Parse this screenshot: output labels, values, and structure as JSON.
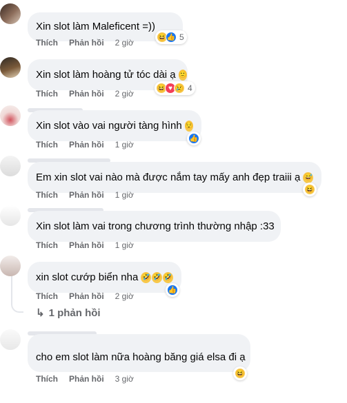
{
  "comments": [
    {
      "text": "Xin slot làm Maleficent =))",
      "reactions": {
        "icons": [
          "haha",
          "like"
        ],
        "count": "5"
      },
      "actions": {
        "like": "Thích",
        "reply": "Phản hồi",
        "time": "2 giờ"
      }
    },
    {
      "text": "Xin slot làm hoàng tử tóc dài ạ",
      "emoji": "slight-smile-emoji",
      "reactions": {
        "icons": [
          "haha",
          "love",
          "sad"
        ],
        "count": "4"
      },
      "actions": {
        "like": "Thích",
        "reply": "Phản hồi",
        "time": "2 giờ"
      }
    },
    {
      "text": "Xin slot vào vai người tàng hình",
      "emoji": "relieved-emoji",
      "reactions": {
        "icons": [
          "like"
        ],
        "count": ""
      },
      "actions": {
        "like": "Thích",
        "reply": "Phản hồi",
        "time": "1 giờ"
      }
    },
    {
      "text": "Em xin slot vai nào mà được nắm tay mấy anh đẹp traiii ạ",
      "emoji": "grinning-sweat-emoji",
      "reactions": {
        "icons": [
          "haha"
        ],
        "count": ""
      },
      "actions": {
        "like": "Thích",
        "reply": "Phản hồi",
        "time": "1 giờ"
      }
    },
    {
      "text": "Xin slot làm vai trong chương trình thường nhập :33",
      "reactions": {
        "icons": [],
        "count": ""
      },
      "actions": {
        "like": "Thích",
        "reply": "Phản hồi",
        "time": "1 giờ"
      }
    },
    {
      "text": "xin slot cướp biển nha",
      "emoji": "rofl-emoji x3",
      "reactions": {
        "icons": [
          "like"
        ],
        "count": ""
      },
      "actions": {
        "like": "Thích",
        "reply": "Phản hồi",
        "time": "2 giờ"
      },
      "view_replies": "1 phản hồi"
    },
    {
      "text": "cho em slot làm nữa hoàng băng giá elsa đi ạ",
      "reactions": {
        "icons": [
          "haha"
        ],
        "count": ""
      },
      "actions": {
        "like": "Thích",
        "reply": "Phản hồi",
        "time": "3 giờ"
      }
    }
  ]
}
